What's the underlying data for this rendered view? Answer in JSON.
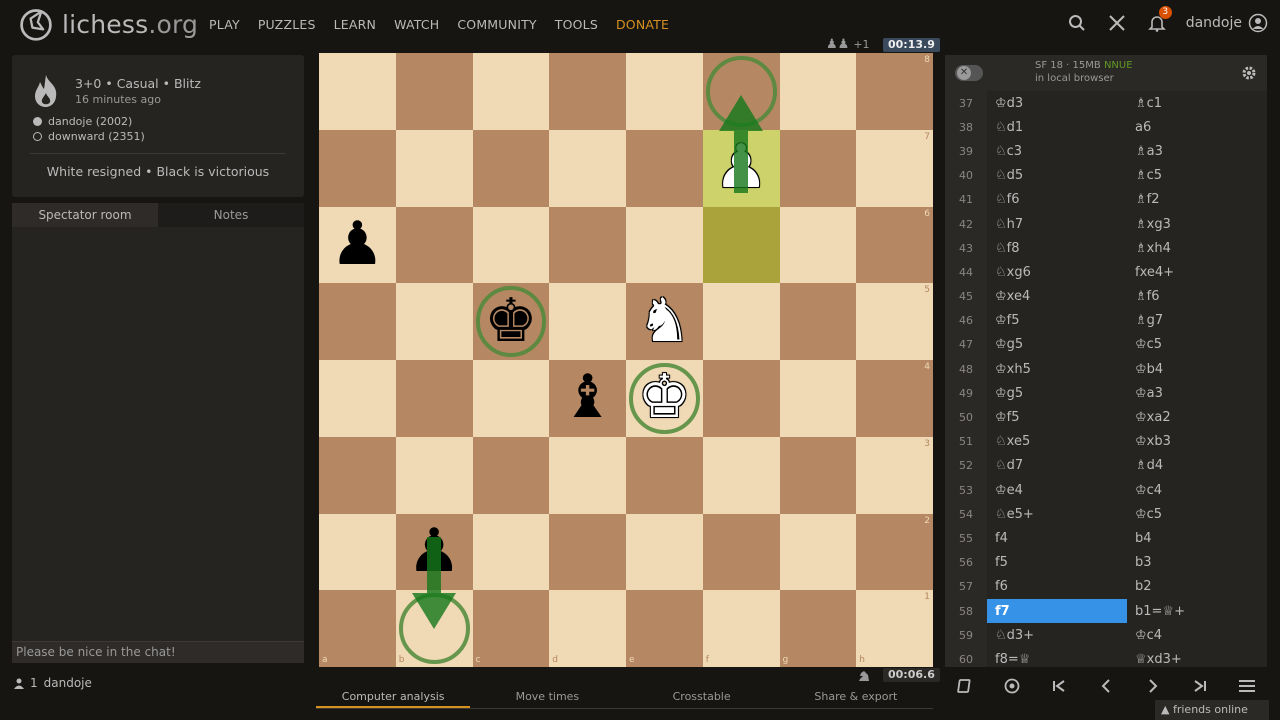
{
  "header": {
    "logo_name": "lichess",
    "logo_tld": ".org",
    "nav": [
      "PLAY",
      "PUZZLES",
      "LEARN",
      "WATCH",
      "COMMUNITY",
      "TOOLS"
    ],
    "donate": "DONATE",
    "notifications": "3",
    "username": "dandoje"
  },
  "game": {
    "setup": "3+0 • Casual • Blitz",
    "time_ago": "16 minutes ago",
    "white_player": "dandoje (2002)",
    "black_player": "downward (2351)",
    "status": "White resigned • Black is victorious"
  },
  "chat": {
    "tabs": [
      "Spectator room",
      "Notes"
    ],
    "placeholder": "Please be nice in the chat!",
    "watcher_count": "1",
    "watcher_name": "dandoje"
  },
  "board": {
    "top_count": "+1",
    "clock_top": "00:13.9",
    "clock_bottom": "00:06.6",
    "files": [
      "a",
      "b",
      "c",
      "d",
      "e",
      "f",
      "g",
      "h"
    ],
    "ranks": [
      "8",
      "7",
      "6",
      "5",
      "4",
      "3",
      "2",
      "1"
    ],
    "pieces": {
      "a6": "bp",
      "c5": "bk",
      "e5": "wn",
      "d4": "bb",
      "e4": "wk",
      "f7": "wp",
      "b2": "bp"
    },
    "highlights": [
      "f7",
      "f6"
    ],
    "rings": [
      "c5",
      "e4",
      "f8",
      "b1"
    ]
  },
  "under_tabs": [
    "Computer analysis",
    "Move times",
    "Crosstable",
    "Share & export"
  ],
  "engine": {
    "name": "SF 18 · 15MB",
    "nnue": "NNUE",
    "where": "in local browser"
  },
  "moves": [
    {
      "n": "37",
      "w": "♔d3",
      "b": "♗c1"
    },
    {
      "n": "38",
      "w": "♘d1",
      "b": "a6"
    },
    {
      "n": "39",
      "w": "♘c3",
      "b": "♗a3"
    },
    {
      "n": "40",
      "w": "♘d5",
      "b": "♗c5"
    },
    {
      "n": "41",
      "w": "♘f6",
      "b": "♗f2"
    },
    {
      "n": "42",
      "w": "♘h7",
      "b": "♗xg3"
    },
    {
      "n": "43",
      "w": "♘f8",
      "b": "♗xh4"
    },
    {
      "n": "44",
      "w": "♘xg6",
      "b": "fxe4+"
    },
    {
      "n": "45",
      "w": "♔xe4",
      "b": "♗f6"
    },
    {
      "n": "46",
      "w": "♔f5",
      "b": "♗g7"
    },
    {
      "n": "47",
      "w": "♔g5",
      "b": "♔c5"
    },
    {
      "n": "48",
      "w": "♔xh5",
      "b": "♔b4"
    },
    {
      "n": "49",
      "w": "♔g5",
      "b": "♔a3"
    },
    {
      "n": "50",
      "w": "♔f5",
      "b": "♔xa2"
    },
    {
      "n": "51",
      "w": "♘xe5",
      "b": "♔xb3"
    },
    {
      "n": "52",
      "w": "♘d7",
      "b": "♗d4"
    },
    {
      "n": "53",
      "w": "♔e4",
      "b": "♔c4"
    },
    {
      "n": "54",
      "w": "♘e5+",
      "b": "♔c5"
    },
    {
      "n": "55",
      "w": "f4",
      "b": "b4"
    },
    {
      "n": "56",
      "w": "f5",
      "b": "b3"
    },
    {
      "n": "57",
      "w": "f6",
      "b": "b2"
    },
    {
      "n": "58",
      "w": "f7",
      "b": "b1=♕+"
    },
    {
      "n": "59",
      "w": "♘d3+",
      "b": "♔c4"
    },
    {
      "n": "60",
      "w": "f8=♕",
      "b": "♕xd3+"
    }
  ],
  "active_move": "58w",
  "friends": "friends online",
  "colors": {
    "light_square": "#f0d9b5",
    "dark_square": "#b58863",
    "highlight": "#cdd26a",
    "arrow": "#4e8a3a",
    "active_move": "#3692e7",
    "donate": "#d59120"
  }
}
